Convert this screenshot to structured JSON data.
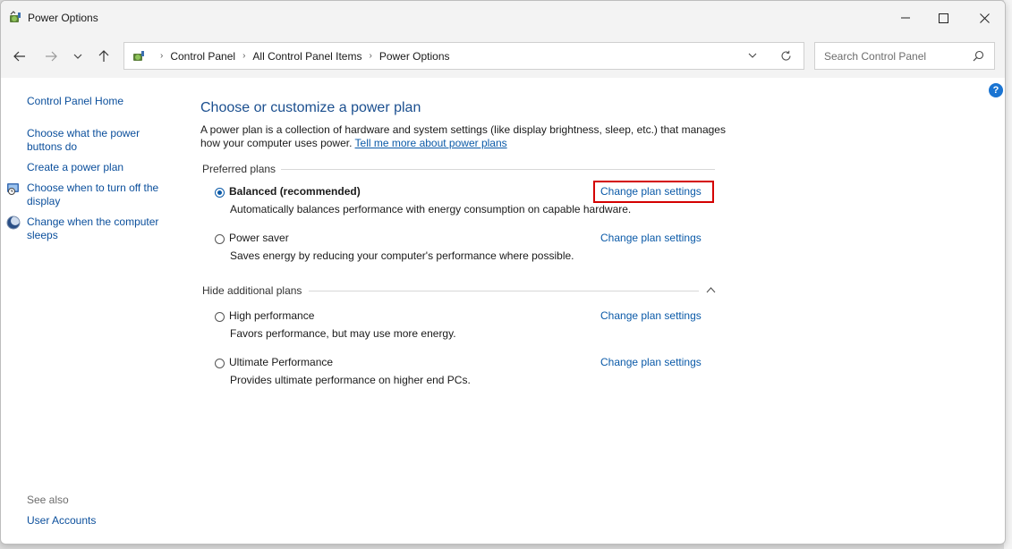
{
  "window": {
    "title": "Power Options"
  },
  "nav": {
    "breadcrumbs": [
      "Control Panel",
      "All Control Panel Items",
      "Power Options"
    ]
  },
  "search": {
    "placeholder": "Search Control Panel"
  },
  "sidebar": {
    "home": "Control Panel Home",
    "items": [
      {
        "label_line1": "Choose what the power",
        "label_line2": "buttons do"
      },
      {
        "label_line1": "Create a power plan"
      },
      {
        "label_line1": "Choose when to turn off the",
        "label_line2": "display"
      },
      {
        "label_line1": "Change when the computer",
        "label_line2": "sleeps"
      }
    ],
    "see_also": "See also",
    "user_accounts": "User Accounts"
  },
  "main": {
    "heading": "Choose or customize a power plan",
    "intro_line1": "A power plan is a collection of hardware and system settings (like display brightness, sleep, etc.) that manages",
    "intro_line2": "how your computer uses power.",
    "intro_link": "Tell me more about power plans",
    "preferred_label": "Preferred plans",
    "hide_label": "Hide additional plans",
    "plans": [
      {
        "name": "Balanced (recommended)",
        "desc": "Automatically balances performance with energy consumption on capable hardware.",
        "link": "Change plan settings",
        "selected": true
      },
      {
        "name": "Power saver",
        "desc": "Saves energy by reducing your computer's performance where possible.",
        "link": "Change plan settings",
        "selected": false
      },
      {
        "name": "High performance",
        "desc": "Favors performance, but may use more energy.",
        "link": "Change plan settings",
        "selected": false
      },
      {
        "name": "Ultimate Performance",
        "desc": "Provides ultimate performance on higher end PCs.",
        "link": "Change plan settings",
        "selected": false
      }
    ]
  },
  "help": {
    "symbol": "?"
  },
  "colors": {
    "link": "#0b5aa8",
    "heading": "#1b4f8f",
    "highlight": "#d40000",
    "accent": "#1a74d2"
  }
}
